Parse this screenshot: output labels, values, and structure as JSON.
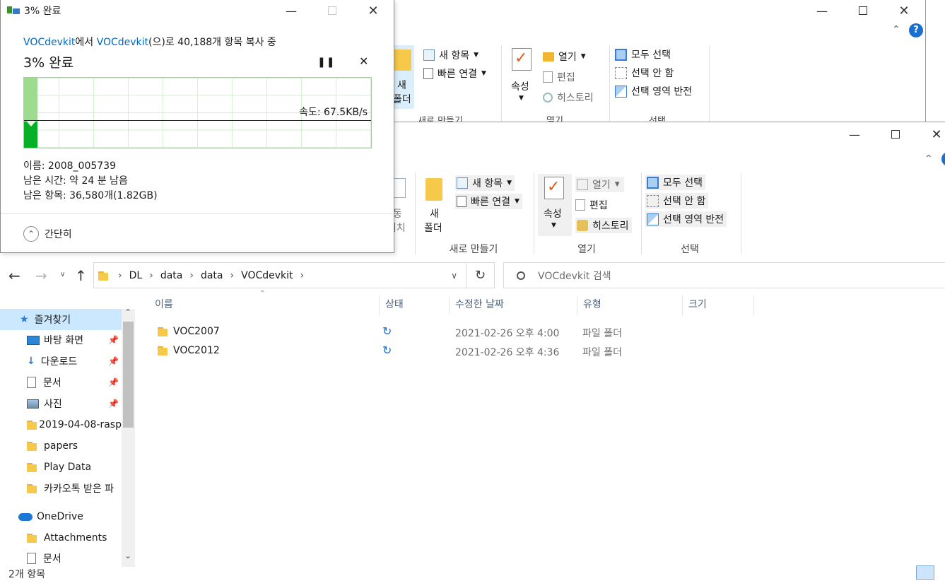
{
  "back_window": {
    "ribbon": {
      "new_folder": "새\n폴더",
      "new_folder_line1": "새",
      "new_folder_line2": "폴더",
      "new_item": "새 항목",
      "quick_access": "빠른 연결",
      "properties": "속성",
      "open": "열기",
      "edit": "편집",
      "history": "히스토리",
      "select_all": "모두 선택",
      "select_none": "선택 안 함",
      "invert_selection": "선택 영역 반전",
      "group_new": "새로 만들기",
      "group_open": "열기",
      "group_select": "선택"
    }
  },
  "copy_dialog": {
    "title": "3% 완료",
    "source": "VOCdevkit",
    "from_suffix": "에서 ",
    "dest": "VOCdevkit",
    "description_suffix": "(으)로 40,188개 항목 복사 중",
    "heading": "3% 완료",
    "speed": "속도: 67.5KB/s",
    "progress_fraction": 0.03,
    "name_line": "이름: 2008_005739",
    "time_left_line": "남은 시간: 약 24 분 남음",
    "items_left_line": "남은 항목: 36,580개(1.82GB)",
    "collapse_label": "간단히"
  },
  "explorer": {
    "ribbon": {
      "move_to_line1": "동",
      "move_to_line2": "위치",
      "new_folder_line1": "새",
      "new_folder_line2": "폴더",
      "new_item": "새 항목",
      "quick_access": "빠른 연결",
      "properties": "속성",
      "open": "열기",
      "edit": "편집",
      "history": "히스토리",
      "select_all": "모두 선택",
      "select_none": "선택 안 함",
      "invert_selection": "선택 영역 반전",
      "group_new": "새로 만들기",
      "group_open": "열기",
      "group_select": "선택"
    },
    "address": {
      "crumbs": [
        "DL",
        "data",
        "data",
        "VOCdevkit"
      ]
    },
    "search": {
      "placeholder": "VOCdevkit 검색"
    },
    "columns": {
      "name": "이름",
      "status": "상태",
      "modified": "수정한 날짜",
      "type": "유형",
      "size": "크기"
    },
    "files": [
      {
        "name": "VOC2007",
        "modified": "2021-02-26 오후 4:00",
        "type": "파일 폴더"
      },
      {
        "name": "VOC2012",
        "modified": "2021-02-26 오후 4:36",
        "type": "파일 폴더"
      }
    ],
    "nav": {
      "quick_access": "즐겨찾기",
      "desktop": "바탕 화면",
      "downloads": "다운로드",
      "documents": "문서",
      "pictures": "사진",
      "folder1": "2019-04-08-rasp",
      "folder2": "papers",
      "folder3": "Play Data",
      "folder4": "카카오톡 받은 파",
      "onedrive": "OneDrive",
      "attachments": "Attachments",
      "od_documents": "문서"
    },
    "status_bar": {
      "count": "2개 항목"
    }
  },
  "colors": {
    "accent": "#0067c0",
    "progress_green": "#06b025",
    "progress_light": "#9ddc8e",
    "nav_selected": "#cce8ff"
  }
}
